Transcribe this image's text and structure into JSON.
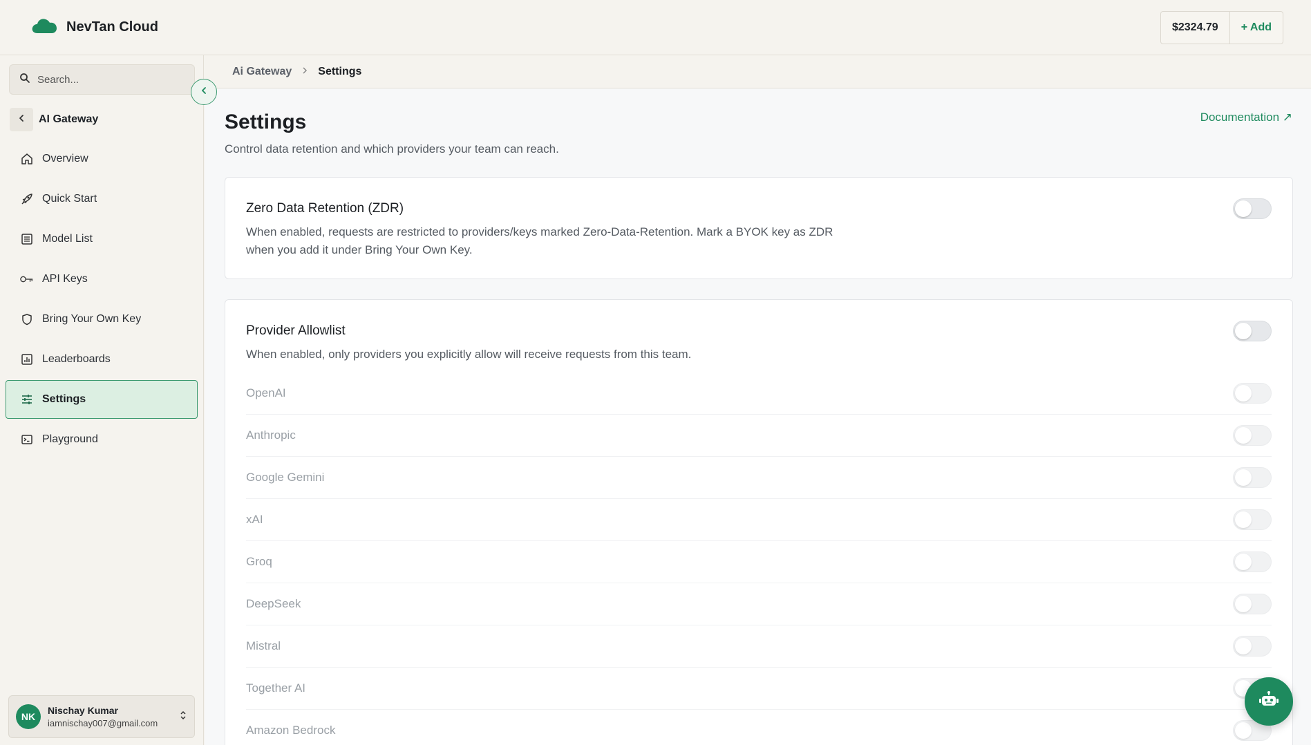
{
  "brand": {
    "name": "NevTan Cloud",
    "logo_icon": "cloud-icon",
    "accent": "#1e8a5e"
  },
  "account": {
    "balance": "$2324.79",
    "add_label": "+ Add"
  },
  "sidebar": {
    "search_placeholder": "Search...",
    "section_title": "AI Gateway",
    "items": [
      {
        "label": "Overview",
        "icon": "home-icon"
      },
      {
        "label": "Quick Start",
        "icon": "rocket-icon"
      },
      {
        "label": "Model List",
        "icon": "list-icon"
      },
      {
        "label": "API Keys",
        "icon": "key-icon"
      },
      {
        "label": "Bring Your Own Key",
        "icon": "shield-icon"
      },
      {
        "label": "Leaderboards",
        "icon": "chart-icon"
      },
      {
        "label": "Settings",
        "icon": "sliders-icon",
        "active": true
      },
      {
        "label": "Playground",
        "icon": "terminal-icon"
      }
    ],
    "user": {
      "initials": "NK",
      "name": "Nischay Kumar",
      "email": "iamnischay007@gmail.com"
    }
  },
  "breadcrumb": {
    "parent": "Ai Gateway",
    "current": "Settings"
  },
  "page": {
    "title": "Settings",
    "subtitle": "Control data retention and which providers your team can reach.",
    "doc_link": "Documentation ↗"
  },
  "zdr": {
    "title": "Zero Data Retention (ZDR)",
    "description": "When enabled, requests are restricted to providers/keys marked Zero-Data-Retention. Mark a BYOK key as ZDR when you add it under Bring Your Own Key.",
    "enabled": false
  },
  "allowlist": {
    "title": "Provider Allowlist",
    "description": "When enabled, only providers you explicitly allow will receive requests from this team.",
    "enabled": false,
    "providers": [
      "OpenAI",
      "Anthropic",
      "Google Gemini",
      "xAI",
      "Groq",
      "DeepSeek",
      "Mistral",
      "Together AI",
      "Amazon Bedrock"
    ]
  }
}
